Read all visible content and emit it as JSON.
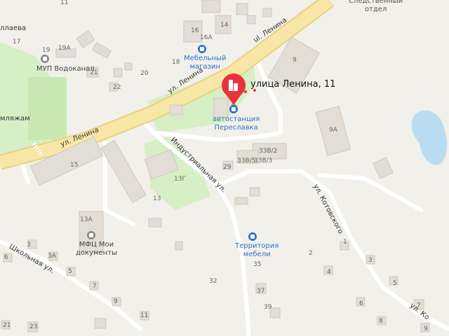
{
  "marker_label": "улица Ленина, 11",
  "colors": {
    "background": "#f2f0ea",
    "main_road": "#f8e6a6",
    "road": "#ffffff",
    "building": "#e2ddd5",
    "park": "#d6efc4",
    "water": "#b9dcf2",
    "poi": "#2b72c8",
    "marker": "#e8333c"
  },
  "streets": {
    "lenina_1": "ул. Ленина",
    "lenina_2": "ul. Ленина",
    "lenina_3": "ул. Ленина",
    "industrialnaya": "Индустриальная ул.",
    "kotovskogo": "ул. Котовского",
    "kotovskogo_2": "ул. Ко",
    "shkolnaya": "Школьная ул.",
    "truncated_1": "ллаева",
    "truncated_2": "мляжам"
  },
  "pois": {
    "investigative": "Следственный\nотдел",
    "furniture_store": "Мебельный\nмагазин",
    "vodokanal": "МУП Водоканал",
    "bus_station": "автостанция\nПереславка",
    "mfc": "МФЦ Мои\nдокументы",
    "furniture_territory": "Территория\nмебели"
  },
  "house_numbers": {
    "n11": "11",
    "n17": "17",
    "n19": "19",
    "n19a": "19А",
    "n21": "21",
    "n22": "22",
    "n20": "20",
    "n18": "18",
    "n16": "16",
    "n16a": "16А",
    "n14": "14",
    "n9": "9",
    "n9a": "9А",
    "n15": "15",
    "n13": "13",
    "n13g": "13Г",
    "n29": "29",
    "n33v2": "33В/2",
    "n33v5": "33В/5",
    "n33v3": "33В/3",
    "n13a": "13А",
    "n32": "32",
    "n35": "35",
    "n37": "37",
    "n39": "39",
    "n2": "2",
    "n1": "1",
    "n3": "3",
    "n4": "4",
    "n5": "5",
    "n6": "6",
    "n7": "7",
    "n8": "8",
    "n9b": "9",
    "n11b": "11",
    "n3a": "3А",
    "n5b": "5",
    "n7b": "7",
    "n9c": "9",
    "n23": "23",
    "n6b": "6",
    "n21b": "21"
  }
}
